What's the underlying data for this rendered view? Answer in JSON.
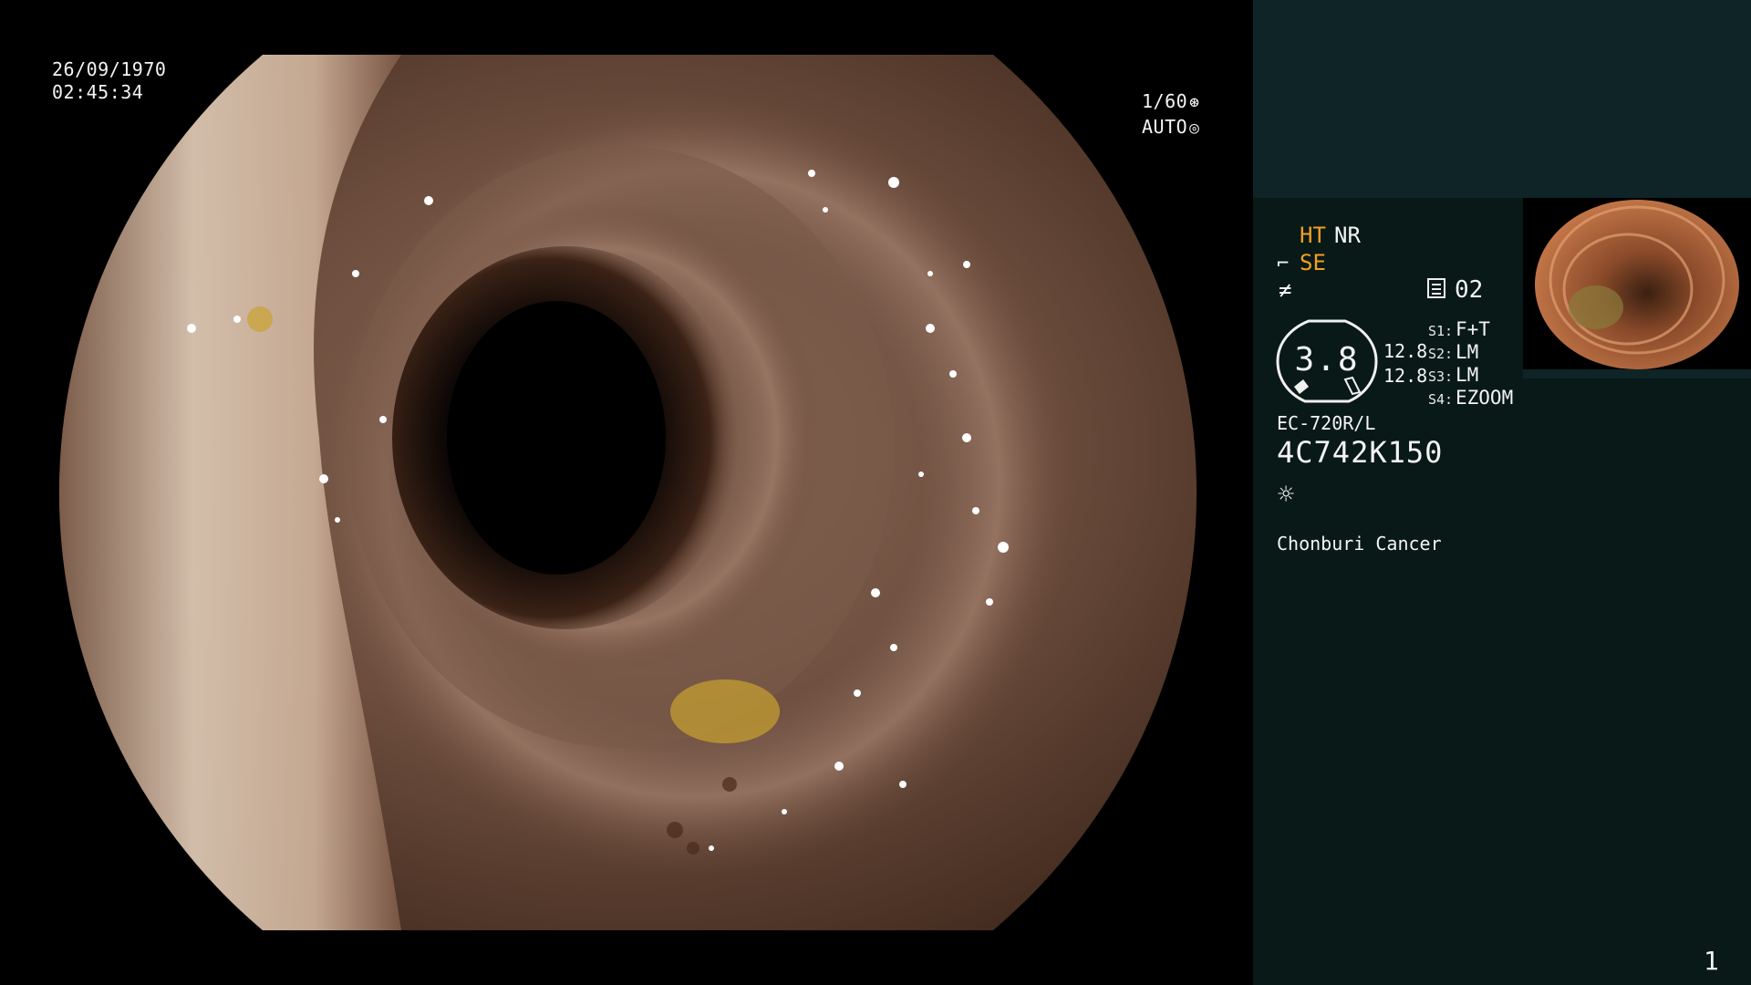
{
  "overlay": {
    "date": "26/09/1970",
    "time": "02:45:34",
    "shutter": "1/60",
    "exposure_mode": "AUTO"
  },
  "panel": {
    "ht": "HT",
    "nr": "NR",
    "se": "SE",
    "memory": "02",
    "gauge_value": "3.8",
    "value_a": "12.8",
    "value_b": "12.8",
    "switches": [
      {
        "label": "S1:",
        "value": "F+T"
      },
      {
        "label": "S2:",
        "value": "LM"
      },
      {
        "label": "S3:",
        "value": "LM"
      },
      {
        "label": "S4:",
        "value": "EZOOM"
      }
    ],
    "scope_model": "EC-720R/L",
    "scope_serial": "4C742K150",
    "institution": "Chonburi Cancer",
    "page_number": "1"
  },
  "icons": {
    "shutter": "shutter-icon",
    "auto": "iris-icon",
    "se": "enhancement-icon",
    "f": "filter-icon",
    "memo": "memo-icon",
    "light": "light-source-icon"
  },
  "colors": {
    "accent": "#f0a020",
    "panel_top": "#0e2427",
    "panel_bottom": "#081917"
  }
}
